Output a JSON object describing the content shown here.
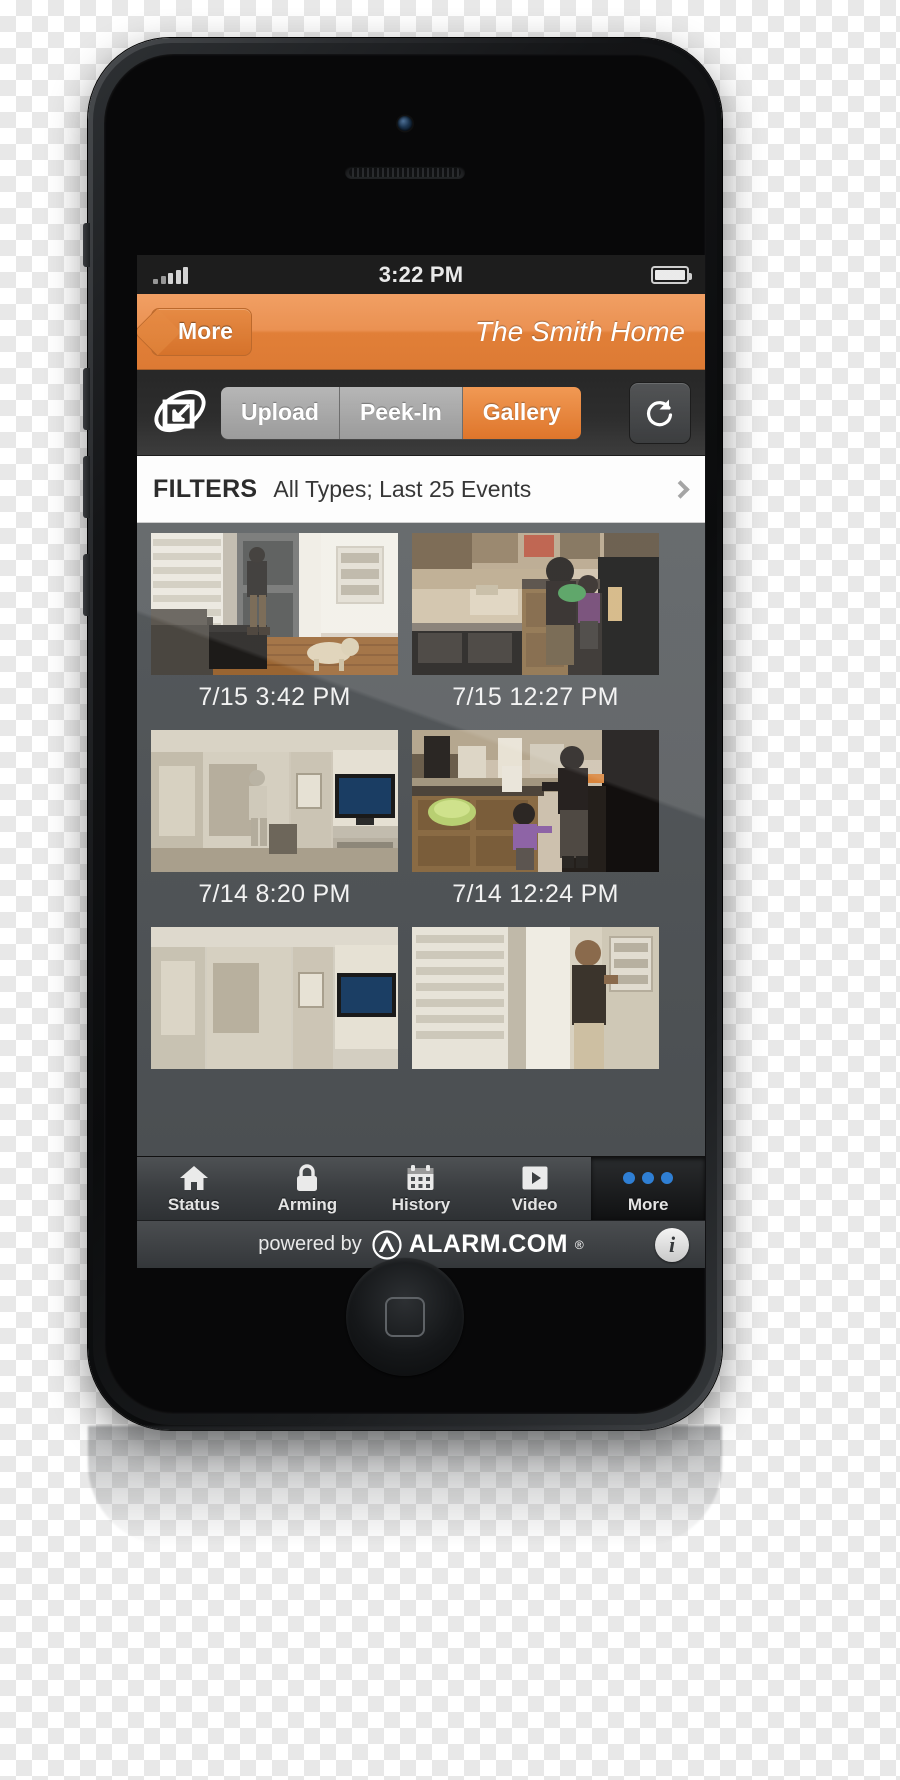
{
  "status_bar": {
    "time": "3:22 PM",
    "signal_icon": "signal-bars-icon",
    "battery_icon": "battery-icon"
  },
  "navbar": {
    "back_label": "More",
    "title": "The Smith Home",
    "accent_color": "#e8833c"
  },
  "toolbar": {
    "camera_icon": "camera-upload-icon",
    "refresh_icon": "refresh-icon",
    "segments": [
      {
        "label": "Upload",
        "active": false
      },
      {
        "label": "Peek-In",
        "active": false
      },
      {
        "label": "Gallery",
        "active": true
      }
    ]
  },
  "filters": {
    "label": "FILTERS",
    "value": "All Types; Last 25 Events",
    "chevron_icon": "chevron-right-icon"
  },
  "gallery": {
    "items": [
      {
        "timestamp": "7/15 3:42 PM",
        "scene": "front-door-man-dog"
      },
      {
        "timestamp": "7/15 12:27 PM",
        "scene": "kitchen-woman-child"
      },
      {
        "timestamp": "7/14 8:20 PM",
        "scene": "living-room-tv"
      },
      {
        "timestamp": "7/14 12:24 PM",
        "scene": "kitchen-woman-toddler"
      },
      {
        "timestamp": "",
        "scene": "hallway-partial"
      },
      {
        "timestamp": "",
        "scene": "entry-man-partial"
      }
    ]
  },
  "tabbar": {
    "items": [
      {
        "label": "Status",
        "icon": "home-icon",
        "active": false
      },
      {
        "label": "Arming",
        "icon": "lock-icon",
        "active": false
      },
      {
        "label": "History",
        "icon": "calendar-icon",
        "active": false
      },
      {
        "label": "Video",
        "icon": "play-icon",
        "active": false
      },
      {
        "label": "More",
        "icon": "more-dots-icon",
        "active": true
      }
    ],
    "more_dot_color": "#2f7fd4"
  },
  "footer": {
    "powered_by": "powered by",
    "brand": "ALARM.COM",
    "registered_mark": "®",
    "brand_icon": "alarm-com-logo-icon",
    "info_icon": "info-icon",
    "info_glyph": "i"
  }
}
